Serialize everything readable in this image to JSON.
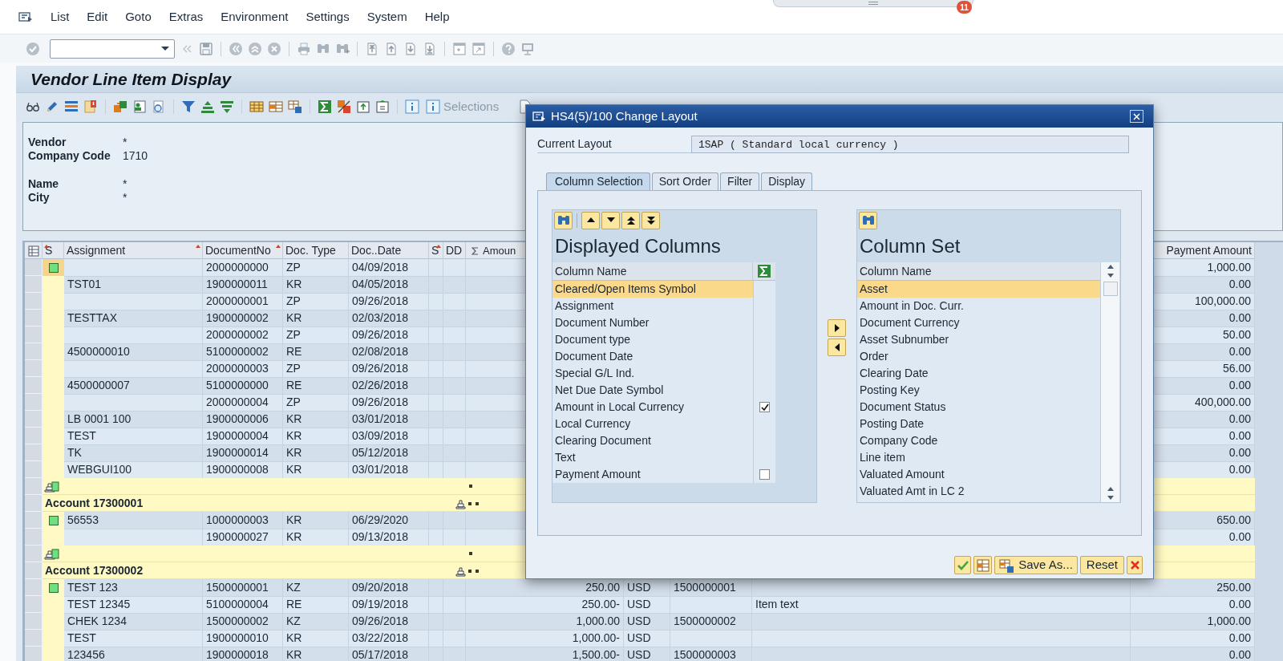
{
  "menu": [
    "List",
    "Edit",
    "Goto",
    "Extras",
    "Environment",
    "Settings",
    "System",
    "Help"
  ],
  "notification_badge": "11",
  "title": "Vendor Line Item Display",
  "app_toolbar": {
    "selections": "Selections"
  },
  "header": {
    "groups": [
      [
        {
          "label": "Vendor",
          "value": "*"
        },
        {
          "label": "Company Code",
          "value": "1710"
        }
      ],
      [
        {
          "label": "Name",
          "value": "*"
        },
        {
          "label": "City",
          "value": "*"
        }
      ]
    ]
  },
  "table": {
    "columns": [
      {
        "label": "S",
        "sorted": true
      },
      {
        "label": "Assignment",
        "sorted": true
      },
      {
        "label": "DocumentNo",
        "sorted": true
      },
      {
        "label": "Doc. Type",
        "sorted": false
      },
      {
        "label": "Doc..Date",
        "sorted": false
      },
      {
        "label": "S",
        "sorted": true
      },
      {
        "label": "DD",
        "sorted": false
      },
      {
        "label": "Amoun",
        "sorted": false,
        "totaled": true
      },
      {
        "label": "Payment Amount",
        "sorted": false
      }
    ],
    "rows": [
      {
        "kind": "item",
        "selected": true,
        "open_icon": true,
        "document_no": "2000000000",
        "doc_type": "ZP",
        "doc_date": "04/09/2018",
        "payment_amount": "1,000.00"
      },
      {
        "kind": "item",
        "selected": false,
        "open_icon": false,
        "assignment": "TST01",
        "document_no": "1900000011",
        "doc_type": "KR",
        "doc_date": "04/05/2018",
        "payment_amount": "0.00"
      },
      {
        "kind": "item",
        "selected": false,
        "open_icon": false,
        "document_no": "2000000001",
        "doc_type": "ZP",
        "doc_date": "09/26/2018",
        "payment_amount": "100,000.00"
      },
      {
        "kind": "item",
        "selected": false,
        "open_icon": false,
        "assignment": "TESTTAX",
        "document_no": "1900000002",
        "doc_type": "KR",
        "doc_date": "02/03/2018",
        "payment_amount": "0.00"
      },
      {
        "kind": "item",
        "selected": false,
        "open_icon": false,
        "document_no": "2000000002",
        "doc_type": "ZP",
        "doc_date": "09/26/2018",
        "payment_amount": "50.00"
      },
      {
        "kind": "item",
        "selected": false,
        "open_icon": false,
        "assignment": "4500000010",
        "document_no": "5100000002",
        "doc_type": "RE",
        "doc_date": "02/08/2018",
        "payment_amount": "0.00"
      },
      {
        "kind": "item",
        "selected": false,
        "open_icon": false,
        "document_no": "2000000003",
        "doc_type": "ZP",
        "doc_date": "09/26/2018",
        "payment_amount": "56.00"
      },
      {
        "kind": "item",
        "selected": false,
        "open_icon": false,
        "assignment": "4500000007",
        "document_no": "5100000000",
        "doc_type": "RE",
        "doc_date": "02/26/2018",
        "payment_amount": "0.00"
      },
      {
        "kind": "item",
        "selected": false,
        "open_icon": false,
        "document_no": "2000000004",
        "doc_type": "ZP",
        "doc_date": "09/26/2018",
        "payment_amount": "400,000.00"
      },
      {
        "kind": "item",
        "selected": false,
        "open_icon": false,
        "assignment": "LB 0001 100",
        "document_no": "1900000006",
        "doc_type": "KR",
        "doc_date": "03/01/2018",
        "payment_amount": "0.00"
      },
      {
        "kind": "item",
        "selected": false,
        "open_icon": false,
        "assignment": "TEST",
        "document_no": "1900000004",
        "doc_type": "KR",
        "doc_date": "03/09/2018",
        "payment_amount": "0.00"
      },
      {
        "kind": "item",
        "selected": false,
        "open_icon": false,
        "assignment": "TK",
        "document_no": "1900000014",
        "doc_type": "KR",
        "doc_date": "05/12/2018",
        "payment_amount": "0.00"
      },
      {
        "kind": "item",
        "selected": false,
        "open_icon": false,
        "assignment": "WEBGUI100",
        "document_no": "1900000008",
        "doc_type": "KR",
        "doc_date": "03/01/2018",
        "payment_amount": "0.00"
      },
      {
        "kind": "subtotal"
      },
      {
        "kind": "account",
        "label": "Account 17300001"
      },
      {
        "kind": "item",
        "selected": false,
        "open_icon": true,
        "assignment": "56553",
        "document_no": "1000000003",
        "doc_type": "KR",
        "doc_date": "06/29/2020",
        "payment_amount": "650.00"
      },
      {
        "kind": "item",
        "selected": false,
        "open_icon": false,
        "document_no": "1900000027",
        "doc_type": "KR",
        "doc_date": "09/13/2018",
        "payment_amount": "0.00"
      },
      {
        "kind": "subtotal"
      },
      {
        "kind": "account",
        "label": "Account 17300002"
      },
      {
        "kind": "item",
        "selected": false,
        "open_icon": true,
        "assignment": "TEST 123",
        "document_no": "1500000001",
        "doc_type": "KZ",
        "doc_date": "09/20/2018",
        "amount": "250.00",
        "currency": "USD",
        "clearing_doc": "1500000001",
        "payment_amount": "250.00"
      },
      {
        "kind": "item",
        "selected": false,
        "open_icon": false,
        "assignment": "TEST 12345",
        "document_no": "5100000004",
        "doc_type": "RE",
        "doc_date": "09/19/2018",
        "amount": "250.00-",
        "currency": "USD",
        "text": "Item text",
        "payment_amount": "0.00"
      },
      {
        "kind": "item",
        "selected": false,
        "open_icon": false,
        "assignment": "CHEK 1234",
        "document_no": "1500000002",
        "doc_type": "KZ",
        "doc_date": "09/26/2018",
        "amount": "1,000.00",
        "currency": "USD",
        "clearing_doc": "1500000002",
        "payment_amount": "1,000.00"
      },
      {
        "kind": "item",
        "selected": false,
        "open_icon": false,
        "assignment": "TEST",
        "document_no": "1900000010",
        "doc_type": "KR",
        "doc_date": "03/22/2018",
        "amount": "1,000.00-",
        "currency": "USD",
        "payment_amount": "0.00"
      },
      {
        "kind": "item",
        "selected": false,
        "open_icon": false,
        "assignment": "123456",
        "document_no": "1900000018",
        "doc_type": "KR",
        "doc_date": "05/17/2018",
        "amount": "1,500.00-",
        "currency": "USD",
        "clearing_doc": "1500000003",
        "payment_amount": "0.00"
      }
    ]
  },
  "dialog": {
    "title": "HS4(5)/100 Change Layout",
    "current_layout": {
      "label": "Current Layout",
      "value": "1SAP ( Standard local currency )"
    },
    "tabs": [
      {
        "label": "Column Selection",
        "selected": true
      },
      {
        "label": "Sort Order",
        "selected": false
      },
      {
        "label": "Filter",
        "selected": false
      },
      {
        "label": "Display",
        "selected": false
      }
    ],
    "displayed_columns": {
      "title": "Displayed Columns",
      "header": "Column Name",
      "items": [
        {
          "label": "Cleared/Open Items Symbol",
          "selected": true,
          "kind": "plain"
        },
        {
          "label": "Assignment",
          "selected": false,
          "kind": "plain"
        },
        {
          "label": "Document Number",
          "selected": false,
          "kind": "plain"
        },
        {
          "label": "Document type",
          "selected": false,
          "kind": "plain"
        },
        {
          "label": "Document Date",
          "selected": false,
          "kind": "plain"
        },
        {
          "label": "Special G/L Ind.",
          "selected": false,
          "kind": "plain"
        },
        {
          "label": "Net Due Date Symbol",
          "selected": false,
          "kind": "plain"
        },
        {
          "label": "Amount in Local Currency",
          "selected": false,
          "kind": "summable",
          "checked": true
        },
        {
          "label": "Local Currency",
          "selected": false,
          "kind": "plain"
        },
        {
          "label": "Clearing Document",
          "selected": false,
          "kind": "plain"
        },
        {
          "label": "Text",
          "selected": false,
          "kind": "plain"
        },
        {
          "label": "Payment Amount",
          "selected": false,
          "kind": "summable",
          "checked": false
        }
      ]
    },
    "column_set": {
      "title": "Column Set",
      "header": "Column Name",
      "items": [
        {
          "label": "Asset",
          "selected": true
        },
        {
          "label": "Amount in Doc. Curr.",
          "selected": false
        },
        {
          "label": "Document Currency",
          "selected": false
        },
        {
          "label": "Asset Subnumber",
          "selected": false
        },
        {
          "label": "Order",
          "selected": false
        },
        {
          "label": "Clearing Date",
          "selected": false
        },
        {
          "label": "Posting Key",
          "selected": false
        },
        {
          "label": "Document Status",
          "selected": false
        },
        {
          "label": "Posting Date",
          "selected": false
        },
        {
          "label": "Company Code",
          "selected": false
        },
        {
          "label": "Line item",
          "selected": false
        },
        {
          "label": "Valuated Amount",
          "selected": false
        },
        {
          "label": "Valuated Amt in LC 2",
          "selected": false
        }
      ]
    },
    "buttons": [
      {
        "kind": "confirm"
      },
      {
        "kind": "layout"
      },
      {
        "kind": "save_as",
        "label": "Save As..."
      },
      {
        "kind": "reset",
        "label": "Reset"
      },
      {
        "kind": "cancel"
      }
    ]
  }
}
